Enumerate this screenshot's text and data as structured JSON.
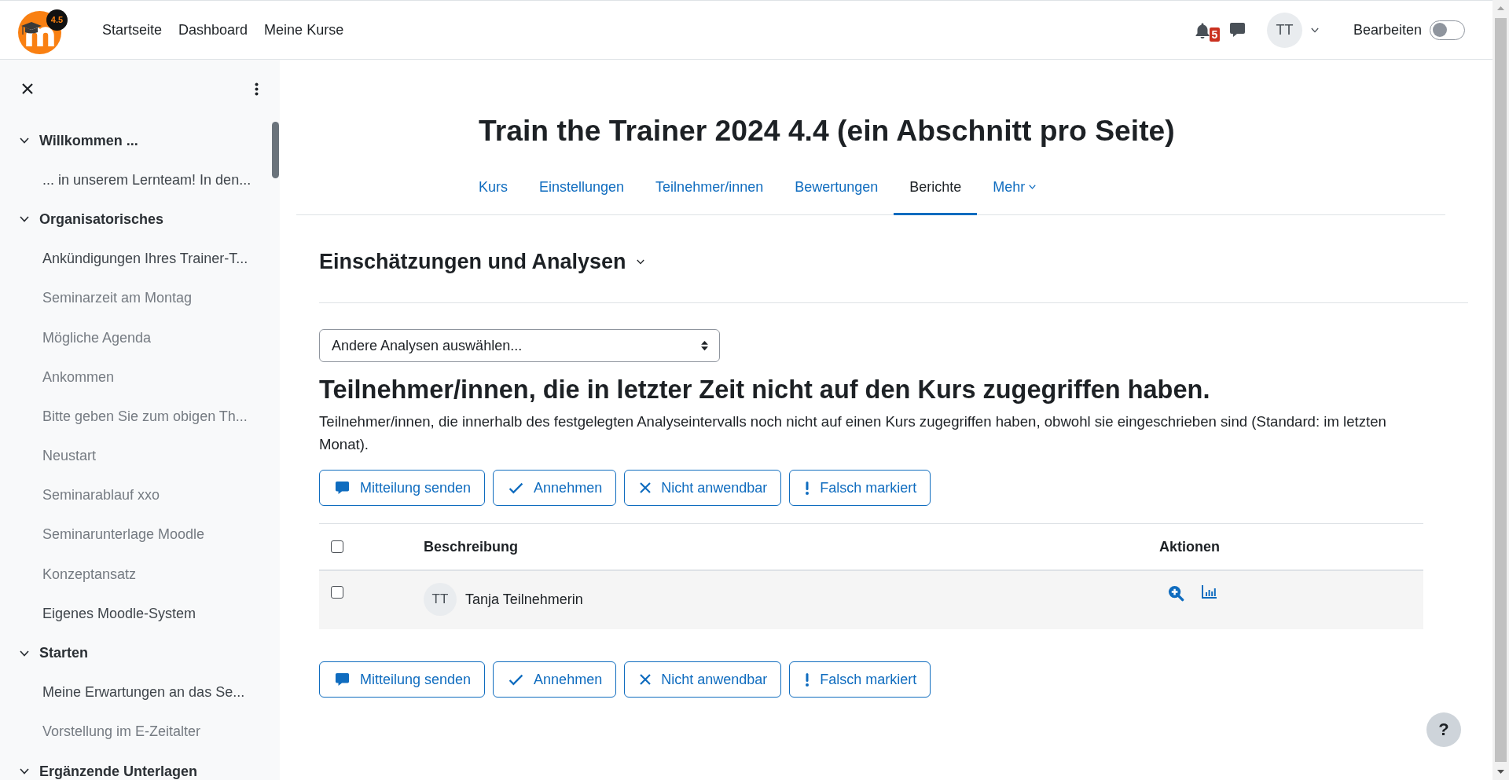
{
  "header": {
    "logo": {
      "badge": "4.5"
    },
    "nav": [
      {
        "label": "Startseite"
      },
      {
        "label": "Dashboard"
      },
      {
        "label": "Meine Kurse"
      }
    ],
    "notifications": {
      "count": "5"
    },
    "user": {
      "initials": "TT"
    },
    "edit_mode": {
      "label": "Bearbeiten",
      "on": false
    }
  },
  "course_index": {
    "sections": [
      {
        "title": "Willkommen ...",
        "expanded": true,
        "children": [
          {
            "label": "... in unserem Lernteam! In den...",
            "dimmed": false
          }
        ]
      },
      {
        "title": "Organisatorisches",
        "expanded": true,
        "children": [
          {
            "label": "Ankündigungen Ihres Trainer-T...",
            "dimmed": false
          },
          {
            "label": "Seminarzeit am Montag",
            "dimmed": true
          },
          {
            "label": "Mögliche Agenda",
            "dimmed": true
          },
          {
            "label": "Ankommen",
            "dimmed": true
          },
          {
            "label": "Bitte geben Sie zum obigen Th...",
            "dimmed": true
          },
          {
            "label": "Neustart",
            "dimmed": true
          },
          {
            "label": "Seminarablauf xxo",
            "dimmed": true
          },
          {
            "label": "Seminarunterlage Moodle",
            "dimmed": true
          },
          {
            "label": "Konzeptansatz",
            "dimmed": true
          },
          {
            "label": "Eigenes Moodle-System",
            "dimmed": false
          }
        ]
      },
      {
        "title": "Starten",
        "expanded": true,
        "children": [
          {
            "label": "Meine Erwartungen an das Se...",
            "dimmed": false
          },
          {
            "label": "Vorstellung im E-Zeitalter",
            "dimmed": true
          }
        ]
      },
      {
        "title": "Ergänzende Unterlagen",
        "expanded": true
      }
    ]
  },
  "course": {
    "title": "Train the Trainer 2024 4.4 (ein Abschnitt pro Seite)",
    "tabs": [
      {
        "label": "Kurs",
        "selected": false,
        "kind": "link"
      },
      {
        "label": "Einstellungen",
        "selected": false,
        "kind": "link"
      },
      {
        "label": "Teilnehmer/innen",
        "selected": false,
        "kind": "link"
      },
      {
        "label": "Bewertungen",
        "selected": false,
        "kind": "link"
      },
      {
        "label": "Berichte",
        "selected": true,
        "kind": "link"
      },
      {
        "label": "Mehr",
        "selected": false,
        "kind": "menu"
      }
    ]
  },
  "report": {
    "heading": "Einschätzungen und Analysen",
    "analysis_select": {
      "value": "Andere Analysen auswählen..."
    },
    "insight_title": "Teilnehmer/innen, die in letzter Zeit nicht auf den Kurs zugegriffen haben.",
    "insight_description": "Teilnehmer/innen, die innerhalb des festgelegten Analyseintervalls noch nicht auf einen Kurs zugegriffen haben, obwohl sie eingeschrieben sind (Standard: im letzten Monat).",
    "actions_top": [
      {
        "kind": "message",
        "label": "Mitteilung senden"
      },
      {
        "kind": "accept",
        "label": "Annehmen"
      },
      {
        "kind": "dismiss",
        "label": "Nicht anwendbar"
      },
      {
        "kind": "flag",
        "label": "Falsch markiert"
      }
    ],
    "table": {
      "select_all": {
        "checked": false
      },
      "columns": [
        "Beschreibung",
        "Aktionen"
      ],
      "rows": [
        {
          "checked": false,
          "initials": "TT",
          "name": "Tanja Teilnehmerin"
        }
      ]
    },
    "actions_bottom": [
      {
        "kind": "message",
        "label": "Mitteilung senden"
      },
      {
        "kind": "accept",
        "label": "Annehmen"
      },
      {
        "kind": "dismiss",
        "label": "Nicht anwendbar"
      },
      {
        "kind": "flag",
        "label": "Falsch markiert"
      }
    ]
  },
  "help_button": {
    "label": "?"
  }
}
